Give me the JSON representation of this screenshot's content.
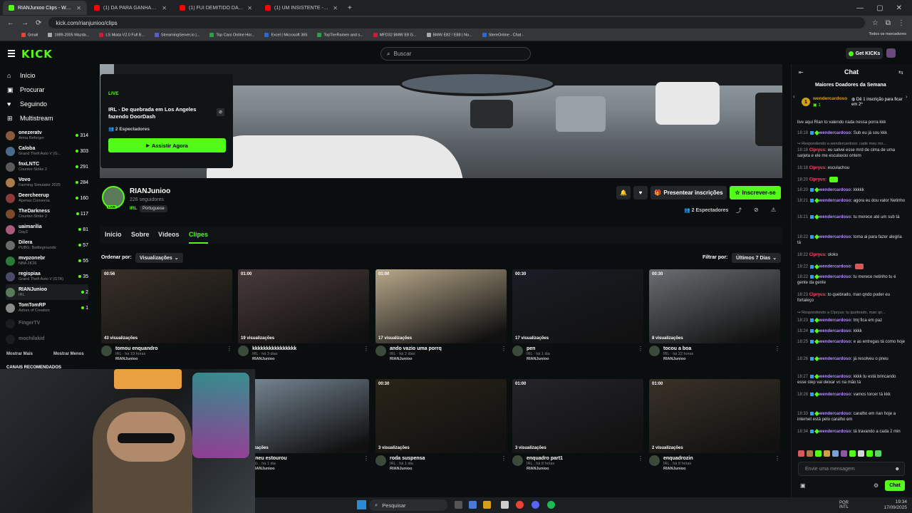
{
  "browser": {
    "tabs": [
      {
        "title": "RIANJunioo Clips - Watch Live",
        "color": "#53fc18",
        "active": true
      },
      {
        "title": "(1) DÁ PARA GANHAR DINHEI",
        "color": "#ff0000",
        "active": false
      },
      {
        "title": "(1) FUI DEMITIDO DA #primaV",
        "color": "#ff0000",
        "active": false
      },
      {
        "title": "(1) UM INSISTENTE - YouTube",
        "color": "#ff0000",
        "active": false
      }
    ],
    "url": "kick.com/rianjunioo/clips",
    "bookmarks": [
      "Gmail",
      "1989-2005 Mazda...",
      "LS Miata V2.0 Full B...",
      "StreamingServer.io |...",
      "Top Cars Online Hor...",
      "Excel | Microsoft 365",
      "TopTierRamen and s...",
      "MFD32 BMW E8 G...",
      "BMW E82 / E88 | No...",
      "StereOnline - Chat -"
    ],
    "bookmarks_all": "Todos os marcadores"
  },
  "header": {
    "logo": "KICK",
    "search_placeholder": "Buscar",
    "get_kicks": "Get KICKs"
  },
  "sidebar": {
    "nav": [
      {
        "label": "Início",
        "icon": "home-icon"
      },
      {
        "label": "Procurar",
        "icon": "browse-icon"
      },
      {
        "label": "Seguindo",
        "icon": "heart-icon"
      },
      {
        "label": "Multistream",
        "icon": "multistream-icon"
      }
    ],
    "channels": [
      {
        "name": "onezeratv",
        "game": "Arma Reforger",
        "viewers": "314",
        "color": "#8a5a3a"
      },
      {
        "name": "Caloba",
        "game": "Grand Theft Auto V (G...",
        "viewers": "303",
        "color": "#4a6a8a"
      },
      {
        "name": "fnxLNTC",
        "game": "Counter-Strike 2",
        "viewers": "291",
        "color": "#5a5a5a"
      },
      {
        "name": "Vovo",
        "game": "Farming Simulator 2025",
        "viewers": "284",
        "color": "#aa7a4a"
      },
      {
        "name": "Deercheerup",
        "game": "Apenas Conversa",
        "viewers": "160",
        "color": "#8a3a3a"
      },
      {
        "name": "TheDarkness",
        "game": "Counter-Strike 2",
        "viewers": "117",
        "color": "#7a4a2a"
      },
      {
        "name": "uaimarilia",
        "game": "DayZ",
        "viewers": "81",
        "color": "#aa5a7a"
      },
      {
        "name": "Dilera",
        "game": "PUBG: Battlegrounds",
        "viewers": "57",
        "color": "#6a6a6a"
      },
      {
        "name": "mvpzonebr",
        "game": "NBA 2K26",
        "viewers": "55",
        "color": "#2a7a3a"
      },
      {
        "name": "regispiaa",
        "game": "Grand Theft Auto V (GTA)",
        "viewers": "35",
        "color": "#4a4a6a"
      },
      {
        "name": "RIANJunioo",
        "game": "IRL",
        "viewers": "2",
        "color": "#5a7a5a"
      },
      {
        "name": "TomTomRP",
        "game": "Ashes of Creation",
        "viewers": "1",
        "color": "#8a8a8a"
      },
      {
        "name": "FingerTV",
        "game": "",
        "viewers": "",
        "color": "#3a3a3a"
      },
      {
        "name": "mochilakid",
        "game": "",
        "viewers": "",
        "color": "#3a3a3a"
      }
    ],
    "show_more": "Mostrar Mais",
    "show_less": "Mostrar Menos",
    "recommended": "CANAIS RECOMENDADOS"
  },
  "live_card": {
    "badge": "LIVE",
    "title": "IRL - De quebrada em Los Angeles fazendo DoorDash",
    "viewers": "2 Espectadores",
    "watch_button": "Assistir Agora"
  },
  "channel": {
    "name": "RIANJunioo",
    "followers": "226 seguidores",
    "category": "IRL",
    "language": "Portuguese",
    "avatar_badge": "LIVE",
    "gift_button": "Presentear inscrições",
    "subscribe_button": "Inscrever-se",
    "viewers": "2 Espectadores"
  },
  "tabs": [
    {
      "label": "Início"
    },
    {
      "label": "Sobre"
    },
    {
      "label": "Vídeos"
    },
    {
      "label": "Clipes",
      "active": true
    }
  ],
  "filters": {
    "sort_label": "Ordenar por:",
    "sort_value": "Visualizações",
    "filter_label": "Filtrar por:",
    "filter_value": "Últimos 7 Dias"
  },
  "clips": [
    {
      "duration": "00:56",
      "views": "43 visualizações",
      "title": "tomou enquandro",
      "meta": "IRL · há 19 horas",
      "author": "RIANJunioo",
      "bg": "#3a3128"
    },
    {
      "duration": "01:00",
      "views": "19 visualizações",
      "title": "kkkkkkkkkkkkkkkk",
      "meta": "IRL · há 3 dias",
      "author": "RIANJunioo",
      "bg": "#4a3a3a"
    },
    {
      "duration": "01:00",
      "views": "17 visualizações",
      "title": "ando vazio uma porrq",
      "meta": "IRL · há 2 dias",
      "author": "RIANJunioo",
      "bg": "#b8a88a"
    },
    {
      "duration": "00:30",
      "views": "17 visualizações",
      "title": "pen",
      "meta": "IRL · há 1 dia",
      "author": "RIANJunioo",
      "bg": "#1a1d24"
    },
    {
      "duration": "00:30",
      "views": "8 visualizações",
      "title": "tocou a boa",
      "meta": "IRL · há 22 horas",
      "author": "RIANJunioo",
      "bg": "#6a6e72"
    },
    {
      "duration": "",
      "views": "visualizações",
      "title": "pneu estourou",
      "meta": "IRL · há 1 dia",
      "author": "RIANJunioo",
      "bg": "#7a8a98"
    },
    {
      "duration": "00:30",
      "views": "3 visualizações",
      "title": "roda suspensa",
      "meta": "IRL · há 1 dia",
      "author": "RIANJunioo",
      "bg": "#2a2418"
    },
    {
      "duration": "01:00",
      "views": "3 visualizações",
      "title": "enquadro part1",
      "meta": "IRL · há 8 horas",
      "author": "RIANJunioo",
      "bg": "#24242a"
    },
    {
      "duration": "01:00",
      "views": "2 visualizações",
      "title": "enquadrozin",
      "meta": "IRL · há 8 horas",
      "author": "RIANJunioo",
      "bg": "#3a3228"
    }
  ],
  "chat": {
    "title": "Chat",
    "top_donors": "Maiores Doadores da Semana",
    "donor_name": "wendercardoso",
    "donor_count": "1",
    "donor_note": "Dê 1 inscrição para ficar em 2º",
    "messages": [
      {
        "ts": "",
        "user": "",
        "text": "live aqui Rian to valendo nada nessa porra kkk",
        "kind": "plain"
      },
      {
        "ts": "18:18",
        "user": "wendercardoso:",
        "text": "Sub eu já sou kkk",
        "kind": "badge"
      },
      {
        "ts": "",
        "user": "",
        "text": "Respondendo a wendercardoso: cade meu mo...",
        "kind": "reply"
      },
      {
        "ts": "18:18",
        "user": "Clpryus:",
        "text": "eu salvei esse mrd de cima de uma sarjeta e ele me esculaxou ontem",
        "kind": "red"
      },
      {
        "ts": "18:18",
        "user": "Clpryus:",
        "text": "esculachou",
        "kind": "red"
      },
      {
        "ts": "18:20",
        "user": "Clpryus:",
        "text": "",
        "kind": "red"
      },
      {
        "ts": "18:20",
        "user": "wendercardoso:",
        "text": "kkkkk",
        "kind": "badge"
      },
      {
        "ts": "18:21",
        "user": "wendercardoso:",
        "text": "agora eu dou valor Netinho",
        "kind": "badge"
      },
      {
        "ts": "18:21",
        "user": "wendercardoso:",
        "text": "tu merece até um sub tá",
        "kind": "badge"
      },
      {
        "ts": "18:22",
        "user": "wendercardoso:",
        "text": "toma ai para fazer alegria tá",
        "kind": "badge"
      },
      {
        "ts": "18:22",
        "user": "Clpryus:",
        "text": "oloko",
        "kind": "red"
      },
      {
        "ts": "18:22",
        "user": "wendercardoso:",
        "text": "",
        "kind": "badge"
      },
      {
        "ts": "18:22",
        "user": "wendercardoso:",
        "text": "tu merece netinho tu é gente da gente",
        "kind": "badge"
      },
      {
        "ts": "18:23",
        "user": "Clpryus:",
        "text": "to quebrado, man qndo puder eu fortaleço",
        "kind": "red"
      },
      {
        "ts": "",
        "user": "",
        "text": "Respondendo a Clpryus: tu quebrado, man qn...",
        "kind": "reply"
      },
      {
        "ts": "18:23",
        "user": "wendercardoso:",
        "text": "tmj fica em paz",
        "kind": "badge"
      },
      {
        "ts": "18:24",
        "user": "wendercardoso:",
        "text": "kkkk",
        "kind": "badge"
      },
      {
        "ts": "18:25",
        "user": "wendercardoso:",
        "text": "e as entregas tá como hoje",
        "kind": "badge"
      },
      {
        "ts": "18:26",
        "user": "wendercardoso:",
        "text": "já resolveu o pneu",
        "kind": "badge"
      },
      {
        "ts": "18:27",
        "user": "wendercardoso:",
        "text": "kkkk tu está brincando esse step vai deixar vc na mão tá",
        "kind": "badge"
      },
      {
        "ts": "18:28",
        "user": "wendercardoso:",
        "text": "vamos torcer tá kkk",
        "kind": "badge"
      },
      {
        "ts": "18:33",
        "user": "wendercardoso:",
        "text": "caralho em rian hoje a internet está pelo caralho em",
        "kind": "badge"
      },
      {
        "ts": "18:34",
        "user": "wendercardoso:",
        "text": "tá travando a cada 2 min",
        "kind": "badge"
      }
    ],
    "input_placeholder": "Envie uma mensagem",
    "send_button": "Chat"
  },
  "taskbar": {
    "search": "Pesquisar",
    "lang": "POR\nINTL",
    "time": "19:34",
    "date": "17/09/2025"
  }
}
